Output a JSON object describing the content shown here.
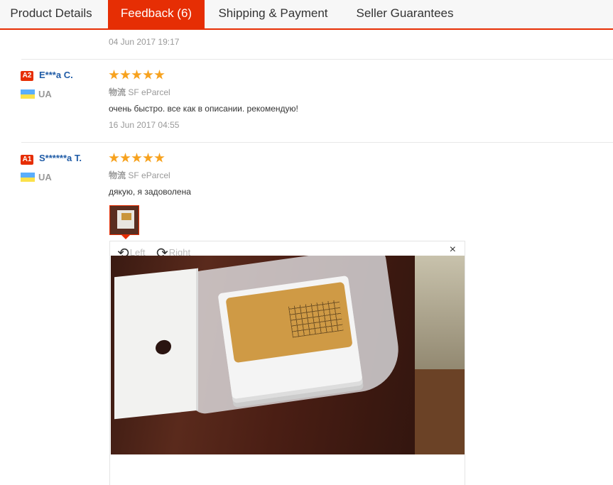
{
  "tabs": [
    {
      "label": "Product Details",
      "active": false
    },
    {
      "label": "Feedback (6)",
      "active": true
    },
    {
      "label": "Shipping & Payment",
      "active": false
    },
    {
      "label": "Seller Guarantees",
      "active": false
    }
  ],
  "prev_review": {
    "date": "04 Jun 2017 19:17"
  },
  "reviews": [
    {
      "badge": "A2",
      "name": "E***a C.",
      "country": "UA",
      "stars": 5,
      "logistics_label": "物流",
      "logistics_value": "SF eParcel",
      "text": "очень быстро. все как в описании. рекомендую!",
      "date": "16 Jun 2017 04:55"
    },
    {
      "badge": "A1",
      "name": "S******a T.",
      "country": "UA",
      "stars": 5,
      "logistics_label": "物流",
      "logistics_value": "SF eParcel",
      "text": "дякую, я задоволена"
    }
  ],
  "viewer": {
    "rotate_left_label": "Left",
    "rotate_right_label": "Right",
    "close_icon": "×"
  },
  "colors": {
    "accent": "#e62e04",
    "star": "#f7a21e",
    "name": "#1f5ba6"
  }
}
